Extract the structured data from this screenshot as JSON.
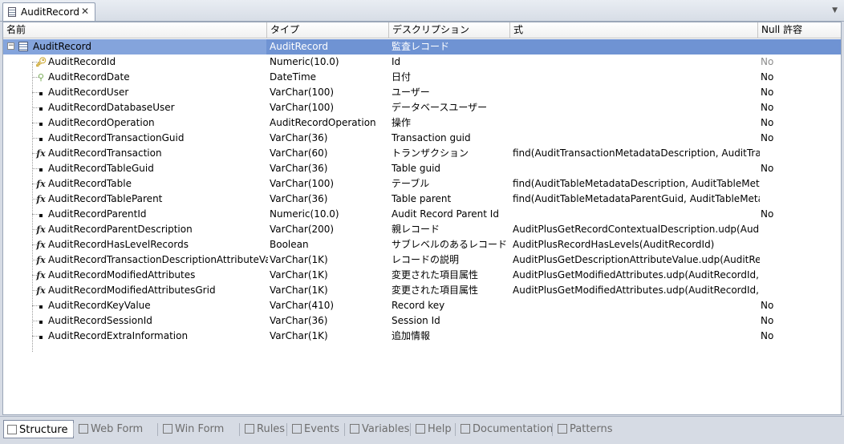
{
  "tab": {
    "title": "AuditRecord",
    "close": "✕",
    "menu": "▼"
  },
  "columns": {
    "name": "名前",
    "type": "タイプ",
    "description": "デスクリプション",
    "formula": "式",
    "nullable": "Null 許容"
  },
  "root": {
    "name": "AuditRecord",
    "type": "AuditRecord",
    "description": "監査レコード",
    "expander": "−"
  },
  "rows": [
    {
      "icon": "key",
      "name": "AuditRecordId",
      "type": "Numeric(10.0)",
      "description": "Id",
      "formula": "",
      "nullable": "No",
      "null_muted": true
    },
    {
      "icon": "search",
      "name": "AuditRecordDate",
      "type": "DateTime",
      "description": "日付",
      "formula": "",
      "nullable": "No"
    },
    {
      "icon": "bullet",
      "name": "AuditRecordUser",
      "type": "VarChar(100)",
      "description": "ユーザー",
      "formula": "",
      "nullable": "No"
    },
    {
      "icon": "bullet",
      "name": "AuditRecordDatabaseUser",
      "type": "VarChar(100)",
      "description": "データベースユーザー",
      "formula": "",
      "nullable": "No"
    },
    {
      "icon": "bullet",
      "name": "AuditRecordOperation",
      "type": "AuditRecordOperation",
      "description": "操作",
      "formula": "",
      "nullable": "No"
    },
    {
      "icon": "bullet",
      "name": "AuditRecordTransactionGuid",
      "type": "VarChar(36)",
      "description": "Transaction guid",
      "formula": "",
      "nullable": "No"
    },
    {
      "icon": "fx",
      "name": "AuditRecordTransaction",
      "type": "VarChar(60)",
      "description": "トランザクション",
      "formula": "find(AuditTransactionMetadataDescription, AuditTran...",
      "nullable": ""
    },
    {
      "icon": "bullet",
      "name": "AuditRecordTableGuid",
      "type": "VarChar(36)",
      "description": "Table guid",
      "formula": "",
      "nullable": "No"
    },
    {
      "icon": "fx",
      "name": "AuditRecordTable",
      "type": "VarChar(100)",
      "description": "テーブル",
      "formula": "find(AuditTableMetadataDescription, AuditTableMeta...",
      "nullable": ""
    },
    {
      "icon": "fx",
      "name": "AuditRecordTableParent",
      "type": "VarChar(36)",
      "description": "Table parent",
      "formula": "find(AuditTableMetadataParentGuid, AuditTableMeta...",
      "nullable": ""
    },
    {
      "icon": "bullet",
      "name": "AuditRecordParentId",
      "type": "Numeric(10.0)",
      "description": "Audit Record Parent Id",
      "formula": "",
      "nullable": "No"
    },
    {
      "icon": "fx",
      "name": "AuditRecordParentDescription",
      "type": "VarChar(200)",
      "description": "親レコード",
      "formula": "AuditPlusGetRecordContextualDescription.udp(Audit...",
      "nullable": ""
    },
    {
      "icon": "fx",
      "name": "AuditRecordHasLevelRecords",
      "type": "Boolean",
      "description": "サブレベルのあるレコード",
      "formula": "AuditPlusRecordHasLevels(AuditRecordId)",
      "nullable": ""
    },
    {
      "icon": "fx",
      "name": "AuditRecordTransactionDescriptionAttributeValue",
      "type": "VarChar(1K)",
      "description": "レコードの説明",
      "formula": "AuditPlusGetDescriptionAttributeValue.udp(AuditRec...",
      "nullable": ""
    },
    {
      "icon": "fx",
      "name": "AuditRecordModifiedAttributes",
      "type": "VarChar(1K)",
      "description": "変更された項目属性",
      "formula": "AuditPlusGetModifiedAttributes.udp(AuditRecordId, f...",
      "nullable": ""
    },
    {
      "icon": "fx",
      "name": "AuditRecordModifiedAttributesGrid",
      "type": "VarChar(1K)",
      "description": "変更された項目属性",
      "formula": "AuditPlusGetModifiedAttributes.udp(AuditRecordId, t...",
      "nullable": ""
    },
    {
      "icon": "bullet",
      "name": "AuditRecordKeyValue",
      "type": "VarChar(410)",
      "description": "Record key",
      "formula": "",
      "nullable": "No"
    },
    {
      "icon": "bullet",
      "name": "AuditRecordSessionId",
      "type": "VarChar(36)",
      "description": "Session Id",
      "formula": "",
      "nullable": "No"
    },
    {
      "icon": "bullet",
      "name": "AuditRecordExtraInformation",
      "type": "VarChar(1K)",
      "description": "追加情報",
      "formula": "",
      "nullable": "No"
    }
  ],
  "bottom_tabs": [
    {
      "label": "Structure",
      "icon": "structure-icon",
      "active": true
    },
    {
      "label": "Web Form",
      "icon": "web-form-icon",
      "active": false
    },
    {
      "label": "Win Form",
      "icon": "win-form-icon",
      "active": false
    },
    {
      "label": "Rules",
      "icon": "rules-icon",
      "active": false
    },
    {
      "label": "Events",
      "icon": "events-icon",
      "active": false
    },
    {
      "label": "Variables",
      "icon": "variables-icon",
      "active": false
    },
    {
      "label": "Help",
      "icon": "help-icon",
      "active": false
    },
    {
      "label": "Documentation",
      "icon": "documentation-icon",
      "active": false
    },
    {
      "label": "Patterns",
      "icon": "patterns-icon",
      "active": false
    }
  ],
  "colors": {
    "selection": "#84a4dc",
    "header_border": "#c5c5c5",
    "muted_text": "#8c8c8c"
  }
}
